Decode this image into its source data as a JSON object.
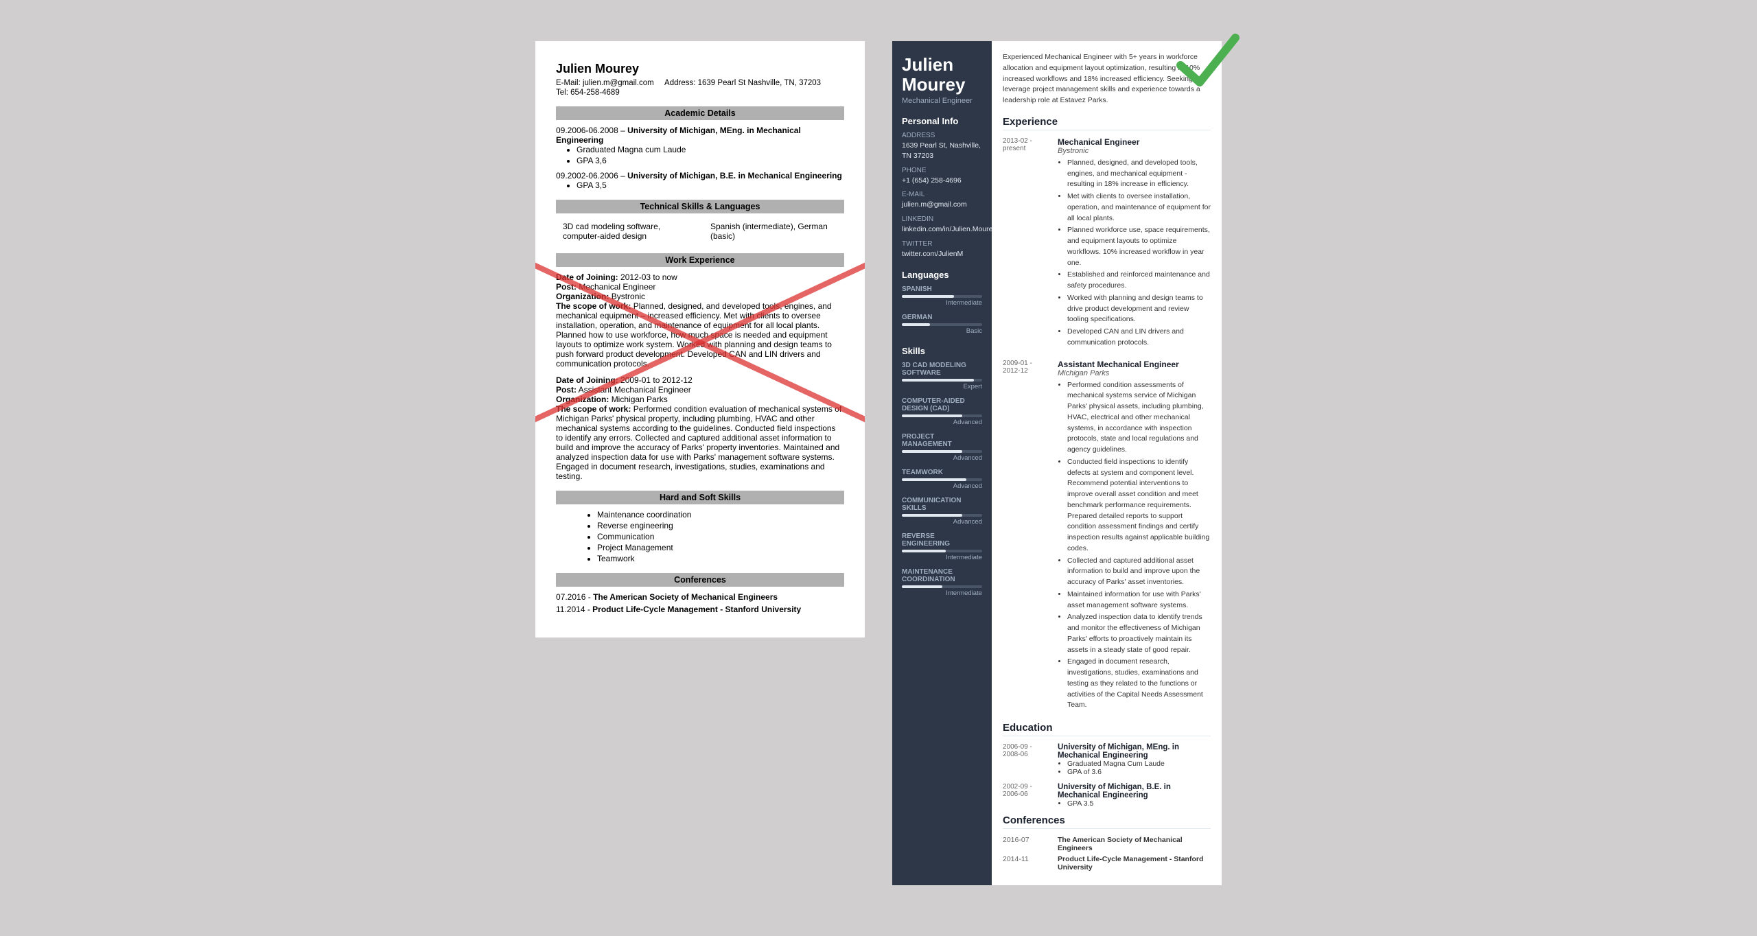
{
  "left_resume": {
    "name": "Julien Mourey",
    "email_label": "E-Mail:",
    "email": "julien.m@gmail.com",
    "address_label": "Address:",
    "address": "1639 Pearl St Nashville, TN, 37203",
    "tel_label": "Tel:",
    "tel": "654-258-4689",
    "sections": {
      "academic": "Academic Details",
      "technical": "Technical Skills & Languages",
      "work": "Work Experience",
      "hard_soft": "Hard and Soft Skills",
      "conferences": "Conferences"
    },
    "education": [
      {
        "dates": "09.2006-06.2008",
        "degree": "University of Michigan, MEng. in Mechanical Engineering",
        "bullets": [
          "Graduated Magna cum Laude",
          "GPA 3,6"
        ]
      },
      {
        "dates": "09.2002-06.2006",
        "degree": "University of Michigan, B.E. in Mechanical Engineering",
        "bullets": [
          "GPA 3,5"
        ]
      }
    ],
    "skills_left": "3D cad modeling software, computer-aided design",
    "skills_right": "Spanish (intermediate), German (basic)",
    "work": [
      {
        "date_label": "Date of Joining:",
        "date": "2012-03 to now",
        "post_label": "Post:",
        "post": "Mechanical Engineer",
        "org_label": "Organization:",
        "org": "Bystronic",
        "scope_label": "The scope of work:",
        "scope": "Planned, designed, and developed tools, engines, and mechanical equipment – increased efficiency. Met with clients to oversee installation, operation, and maintenance of equipment for all local plants. Planned how to use workforce, how much space is needed and equipment layouts to optimize work system. Worked with planning and design teams to push forward product development. Developed CAN and LIN drivers and communication protocols."
      },
      {
        "date_label": "Date of Joining:",
        "date": "2009-01 to 2012-12",
        "post_label": "Post:",
        "post": "Assistant Mechanical Engineer",
        "org_label": "Organization:",
        "org": "Michigan Parks",
        "scope_label": "The scope of work:",
        "scope": "Performed condition evaluation of mechanical systems of Michigan Parks' physical property, including plumbing, HVAC and other mechanical systems according to the guidelines. Conducted field inspections to identify any errors. Collected and captured additional asset information to build and improve the accuracy of Parks' property inventories. Maintained and analyzed inspection data for use with Parks' management software systems. Engaged in document research, investigations, studies, examinations and testing."
      }
    ],
    "hard_soft_skills": [
      "Maintenance coordination",
      "Reverse engineering",
      "Communication",
      "Project Management",
      "Teamwork"
    ],
    "conferences": [
      {
        "date": "07.2016",
        "name": "The American Society of Mechanical Engineers"
      },
      {
        "date": "11.2014",
        "name": "Product Life-Cycle Management - Stanford University"
      }
    ]
  },
  "right_resume": {
    "first_name": "Julien",
    "last_name": "Mourey",
    "title": "Mechanical Engineer",
    "summary": "Experienced Mechanical Engineer with 5+ years in workforce allocation and equipment layout optimization, resulting in 10% increased workflows and 18% increased efficiency. Seeking to leverage project management skills and experience towards a leadership role at Estavez Parks.",
    "personal_info": {
      "section_label": "Personal Info",
      "address_label": "Address",
      "address": "1639 Pearl St, Nashville, TN 37203",
      "phone_label": "Phone",
      "phone": "+1 (654) 258-4696",
      "email_label": "E-mail",
      "email": "julien.m@gmail.com",
      "linkedin_label": "LinkedIn",
      "linkedin": "linkedin.com/in/Julien.Mourey",
      "twitter_label": "Twitter",
      "twitter": "twitter.com/JulienM"
    },
    "languages": {
      "section_label": "Languages",
      "items": [
        {
          "name": "SPANISH",
          "level": "Intermediate",
          "pct": 65
        },
        {
          "name": "GERMAN",
          "level": "Basic",
          "pct": 35
        }
      ]
    },
    "skills": {
      "section_label": "Skills",
      "items": [
        {
          "name": "3D CAD MODELING SOFTWARE",
          "level": "Expert",
          "pct": 90
        },
        {
          "name": "COMPUTER-AIDED DESIGN (CAD)",
          "level": "Advanced",
          "pct": 75
        },
        {
          "name": "PROJECT MANAGEMENT",
          "level": "Advanced",
          "pct": 75
        },
        {
          "name": "TEAMWORK",
          "level": "Advanced",
          "pct": 80
        },
        {
          "name": "COMMUNICATION SKILLS",
          "level": "Advanced",
          "pct": 75
        },
        {
          "name": "REVERSE ENGINEERING",
          "level": "Intermediate",
          "pct": 55
        },
        {
          "name": "MAINTENANCE COORDINATION",
          "level": "Intermediate",
          "pct": 50
        }
      ]
    },
    "experience": {
      "section_label": "Experience",
      "items": [
        {
          "dates": "2013-02 -\npresent",
          "title": "Mechanical Engineer",
          "org": "Bystronic",
          "bullets": [
            "Planned, designed, and developed tools, engines, and mechanical equipment - resulting in 18% increase in efficiency.",
            "Met with clients to oversee installation, operation, and maintenance of equipment for all local plants.",
            "Planned workforce use, space requirements, and equipment layouts to optimize workflows. 10% increased workflow in year one.",
            "Established and reinforced maintenance and safety procedures.",
            "Worked with planning and design teams to drive product development and review tooling specifications.",
            "Developed CAN and LIN drivers and communication protocols."
          ]
        },
        {
          "dates": "2009-01 -\n2012-12",
          "title": "Assistant Mechanical Engineer",
          "org": "Michigan Parks",
          "bullets": [
            "Performed condition assessments of mechanical systems service of Michigan Parks' physical assets, including plumbing, HVAC, electrical and other mechanical systems, in accordance with inspection protocols, state and local regulations and agency guidelines.",
            "Conducted field inspections to identify defects at system and component level. Recommend potential interventions to improve overall asset condition and meet benchmark performance requirements. Prepared detailed reports to support condition assessment findings and certify inspection results against applicable building codes.",
            "Collected and captured additional asset information to build and improve upon the accuracy of Parks' asset inventories.",
            "Maintained information for use with Parks' asset management software systems.",
            "Analyzed inspection data to identify trends and monitor the effectiveness of Michigan Parks' efforts to proactively maintain its assets in a steady state of good repair.",
            "Engaged in document research, investigations, studies, examinations and testing as they related to the functions or activities of the Capital Needs Assessment Team."
          ]
        }
      ]
    },
    "education": {
      "section_label": "Education",
      "items": [
        {
          "dates": "2006-09 -\n2008-06",
          "title": "University of Michigan, MEng. in Mechanical Engineering",
          "bullets": [
            "Graduated Magna Cum Laude",
            "GPA of 3.6"
          ]
        },
        {
          "dates": "2002-09 -\n2006-06",
          "title": "University of Michigan, B.E. in Mechanical Engineering",
          "bullets": [
            "GPA 3.5"
          ]
        }
      ]
    },
    "conferences": {
      "section_label": "Conferences",
      "items": [
        {
          "date": "2016-07",
          "name": "The American Society of Mechanical Engineers"
        },
        {
          "date": "2014-11",
          "name": "Product Life-Cycle Management - Stanford University"
        }
      ]
    }
  }
}
